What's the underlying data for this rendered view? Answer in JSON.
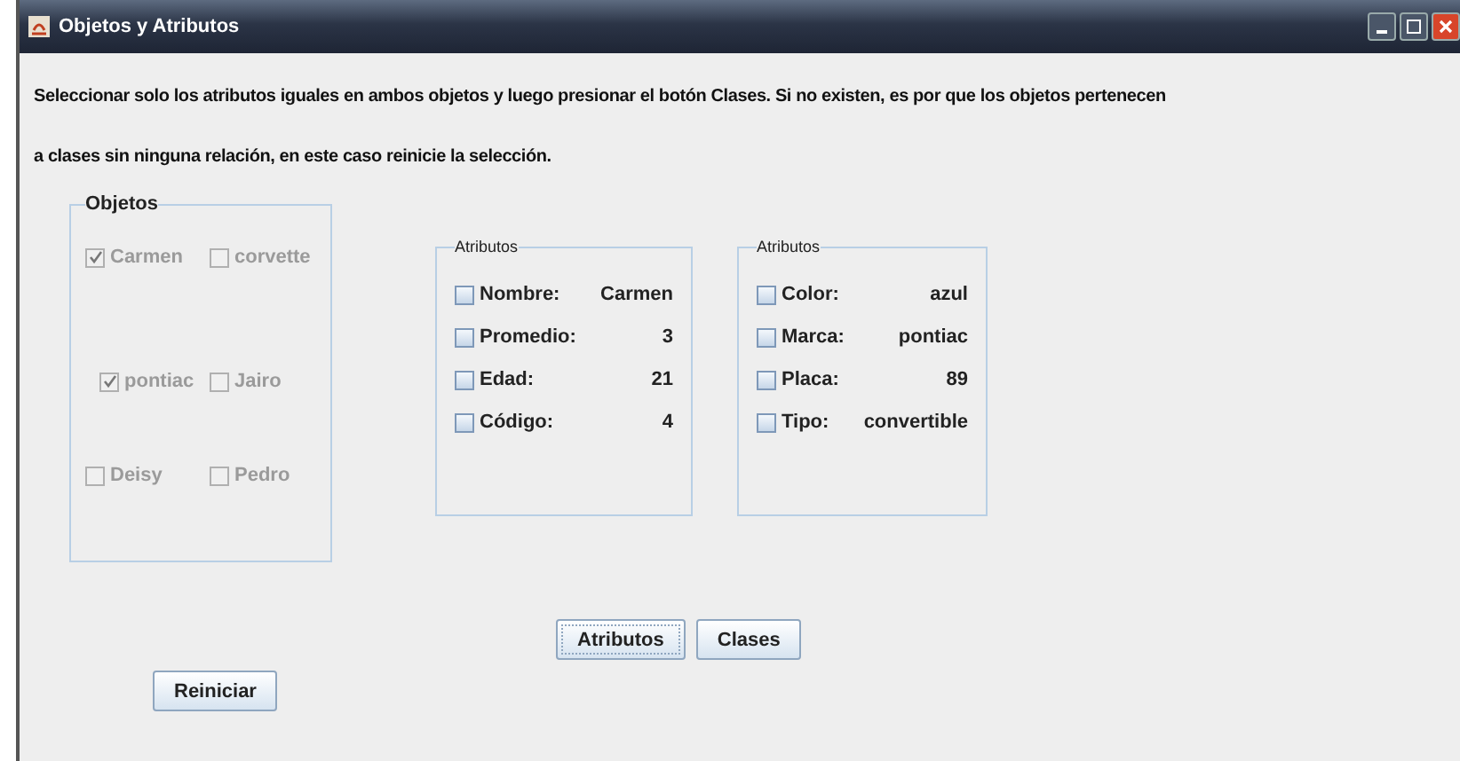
{
  "window": {
    "title": "Objetos y Atributos"
  },
  "instructions": [
    "Seleccionar solo los atributos iguales en ambos objetos y luego presionar el botón Clases. Si no existen, es por que los objetos pertenecen",
    "a clases sin ninguna relación, en este caso reinicie la selección."
  ],
  "objects_panel": {
    "title": "Objetos",
    "items": [
      {
        "label": "Carmen",
        "checked": true,
        "disabled": true
      },
      {
        "label": "corvette",
        "checked": false,
        "disabled": true
      },
      {
        "label": "pontiac",
        "checked": true,
        "disabled": true
      },
      {
        "label": "Jairo",
        "checked": false,
        "disabled": true
      },
      {
        "label": "Deisy",
        "checked": false,
        "disabled": true
      },
      {
        "label": "Pedro",
        "checked": false,
        "disabled": true
      }
    ]
  },
  "attribute_panels": [
    {
      "title": "Atributos",
      "rows": [
        {
          "label": "Nombre:",
          "value": "Carmen",
          "checked": false
        },
        {
          "label": "Promedio:",
          "value": "3",
          "checked": false
        },
        {
          "label": "Edad:",
          "value": "21",
          "checked": false
        },
        {
          "label": "Código:",
          "value": "4",
          "checked": false
        }
      ]
    },
    {
      "title": "Atributos",
      "rows": [
        {
          "label": "Color:",
          "value": "azul",
          "checked": false
        },
        {
          "label": "Marca:",
          "value": "pontiac",
          "checked": false
        },
        {
          "label": "Placa:",
          "value": "89",
          "checked": false
        },
        {
          "label": "Tipo:",
          "value": "convertible",
          "checked": false
        }
      ]
    }
  ],
  "buttons": [
    {
      "label": "Atributos",
      "focused": true
    },
    {
      "label": "Clases",
      "focused": false
    }
  ],
  "reset_button": {
    "label": "Reiniciar"
  }
}
